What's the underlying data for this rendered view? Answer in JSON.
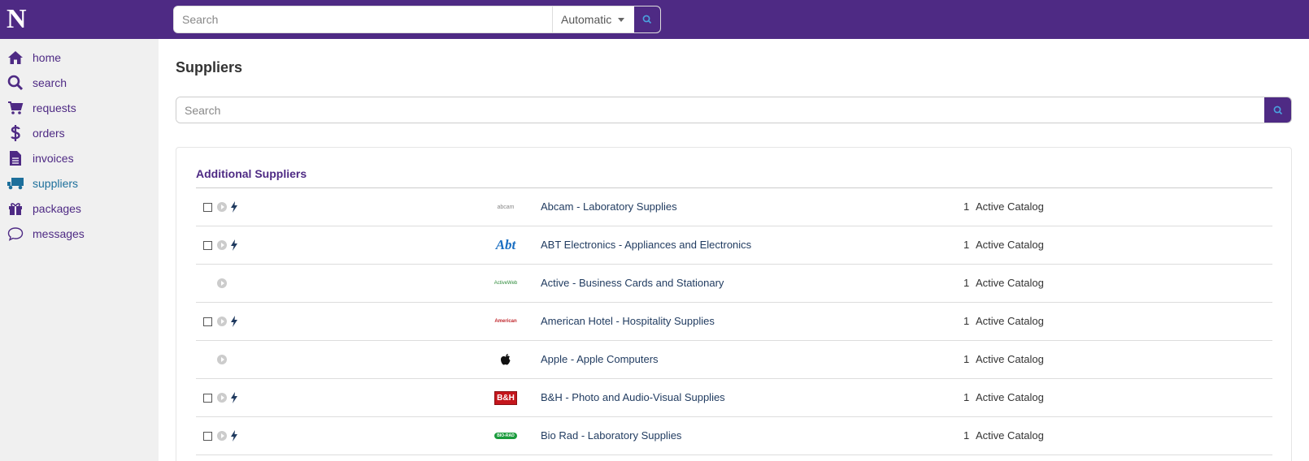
{
  "brand": {
    "logo_letter": "N",
    "accent": "#4e2a84",
    "link": "#1d6f9b"
  },
  "header": {
    "search_placeholder": "Search",
    "search_mode": "Automatic"
  },
  "sidebar": {
    "items": [
      {
        "label": "home",
        "icon": "home-icon"
      },
      {
        "label": "search",
        "icon": "search-icon"
      },
      {
        "label": "requests",
        "icon": "cart-icon"
      },
      {
        "label": "orders",
        "icon": "dollar-icon"
      },
      {
        "label": "invoices",
        "icon": "document-icon"
      },
      {
        "label": "suppliers",
        "icon": "truck-icon",
        "active": true
      },
      {
        "label": "packages",
        "icon": "gift-icon"
      },
      {
        "label": "messages",
        "icon": "chat-icon"
      }
    ]
  },
  "main": {
    "title": "Suppliers",
    "search_placeholder": "Search",
    "section_title": "Additional Suppliers",
    "suppliers": [
      {
        "name": "Abcam - Laboratory Supplies",
        "count": "1",
        "status": "Active Catalog",
        "checkbox": true,
        "bolt": true,
        "logo": "abcam"
      },
      {
        "name": "ABT Electronics - Appliances and Electronics",
        "count": "1",
        "status": "Active Catalog",
        "checkbox": true,
        "bolt": true,
        "logo": "Abt"
      },
      {
        "name": "Active - Business Cards and Stationary",
        "count": "1",
        "status": "Active Catalog",
        "checkbox": false,
        "bolt": false,
        "logo": "ActiveWeb"
      },
      {
        "name": "American Hotel - Hospitality Supplies",
        "count": "1",
        "status": "Active Catalog",
        "checkbox": true,
        "bolt": true,
        "logo": "American"
      },
      {
        "name": "Apple - Apple Computers",
        "count": "1",
        "status": "Active Catalog",
        "checkbox": false,
        "bolt": false,
        "logo": "apple"
      },
      {
        "name": "B&H - Photo and Audio-Visual Supplies",
        "count": "1",
        "status": "Active Catalog",
        "checkbox": true,
        "bolt": true,
        "logo": "B&H"
      },
      {
        "name": "Bio Rad - Laboratory Supplies",
        "count": "1",
        "status": "Active Catalog",
        "checkbox": true,
        "bolt": true,
        "logo": "BIO-RAD"
      }
    ]
  }
}
